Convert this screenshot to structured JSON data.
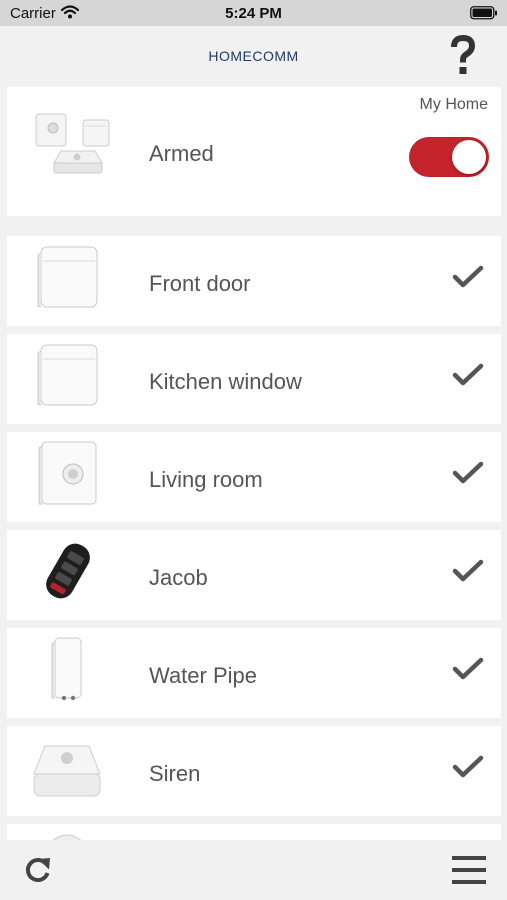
{
  "status_bar": {
    "carrier": "Carrier",
    "time": "5:24 PM",
    "icons": [
      "wifi-icon",
      "battery-icon"
    ]
  },
  "nav": {
    "title": "HOMECOMM",
    "help_icon": "question-mark-icon"
  },
  "home": {
    "name": "My Home",
    "state_label": "Armed",
    "armed": true,
    "toggle_color": "#c4232b"
  },
  "devices": [
    {
      "label": "Front door",
      "icon": "door-sensor-icon",
      "ok": true
    },
    {
      "label": "Kitchen window",
      "icon": "window-sensor-icon",
      "ok": true
    },
    {
      "label": "Living room",
      "icon": "motion-sensor-icon",
      "ok": true
    },
    {
      "label": "Jacob",
      "icon": "key-fob-icon",
      "ok": true
    },
    {
      "label": "Water Pipe",
      "icon": "water-sensor-icon",
      "ok": true
    },
    {
      "label": "Siren",
      "icon": "siren-icon",
      "ok": true
    }
  ],
  "bottom_bar": {
    "left_icon": "refresh-icon",
    "right_icon": "menu-icon"
  }
}
